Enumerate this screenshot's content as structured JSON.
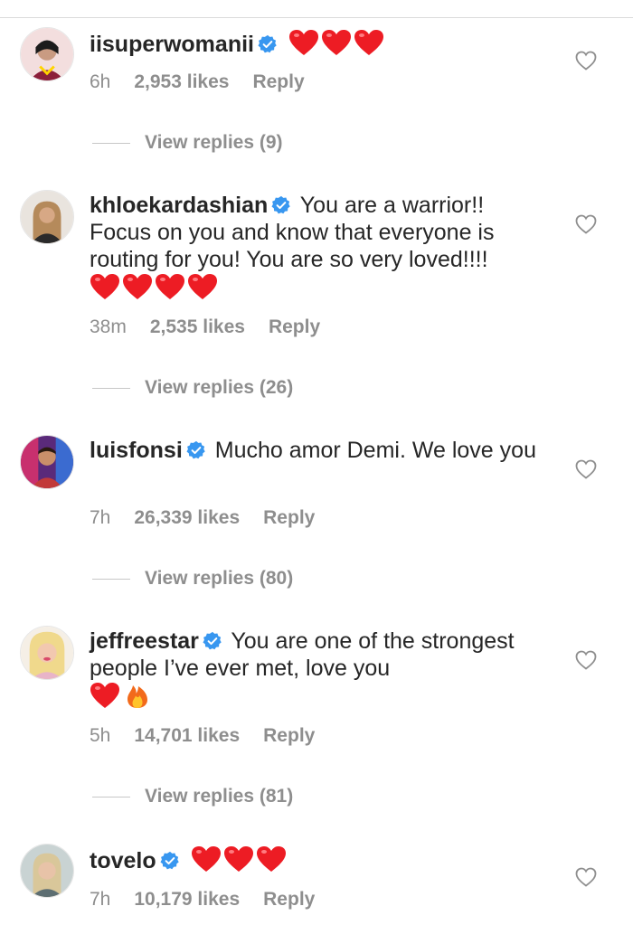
{
  "comments": [
    {
      "username": "iisuperwomanii",
      "verified": true,
      "text": "",
      "emoji": [
        "red-heart",
        "red-heart",
        "red-heart"
      ],
      "time": "6h",
      "likes": "2,953 likes",
      "reply": "Reply",
      "view_replies": "View replies (9)"
    },
    {
      "username": "khloekardashian",
      "verified": true,
      "text": "You are a warrior!! Focus on you and know that everyone is routing for you! You are so very loved!!!!",
      "emoji": [
        "red-heart",
        "red-heart",
        "red-heart",
        "red-heart"
      ],
      "time": "38m",
      "likes": "2,535 likes",
      "reply": "Reply",
      "view_replies": "View replies (26)"
    },
    {
      "username": "luisfonsi",
      "verified": true,
      "text": "Mucho amor Demi. We love you",
      "emoji": [],
      "time": "7h",
      "likes": "26,339 likes",
      "reply": "Reply",
      "view_replies": "View replies (80)"
    },
    {
      "username": "jeffreestar",
      "verified": true,
      "text": "You are one of the strongest people I’ve ever met, love you",
      "emoji": [
        "red-heart",
        "fire"
      ],
      "time": "5h",
      "likes": "14,701 likes",
      "reply": "Reply",
      "view_replies": "View replies (81)"
    },
    {
      "username": "tovelo",
      "verified": true,
      "text": "",
      "emoji": [
        "red-heart",
        "red-heart",
        "red-heart"
      ],
      "time": "7h",
      "likes": "10,179 likes",
      "reply": "Reply"
    }
  ],
  "colors": {
    "verified_blue": "#3897f0",
    "heart_red": "#ed1c24",
    "muted_text": "#8e8e8e"
  }
}
